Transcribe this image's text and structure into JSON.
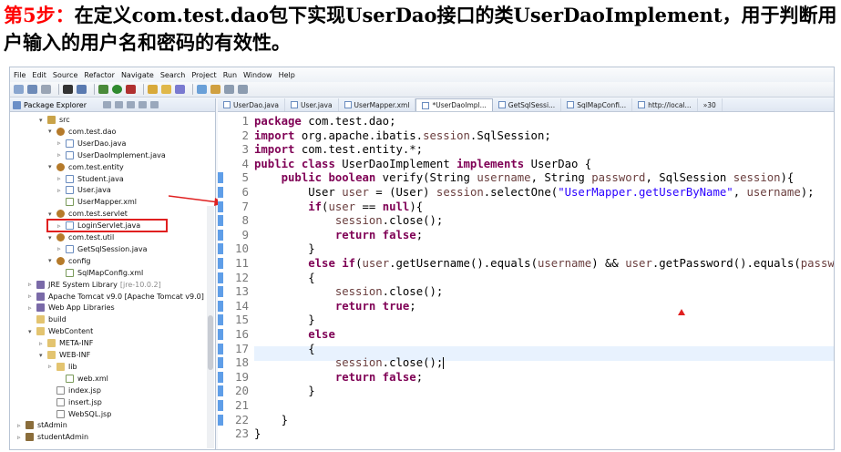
{
  "heading": {
    "step_label": "第5步：",
    "text": "在定义com.test.dao包下实现UserDao接口的类UserDaoImplement，用于判断用户输入的用户名和密码的有效性。"
  },
  "menu": [
    "File",
    "Edit",
    "Source",
    "Refactor",
    "Navigate",
    "Search",
    "Project",
    "Run",
    "Window",
    "Help"
  ],
  "explorer": {
    "title": "Package Explorer",
    "tree": [
      {
        "label": "src",
        "icon": "src",
        "arrow": "▾"
      },
      {
        "label": "com.test.dao",
        "icon": "pkg",
        "arrow": "▾"
      },
      {
        "label": "UserDao.java",
        "icon": "java",
        "arrow": "▹"
      },
      {
        "label": "UserDaoImplement.java",
        "icon": "java",
        "arrow": "▹"
      },
      {
        "label": "com.test.entity",
        "icon": "pkg",
        "arrow": "▾"
      },
      {
        "label": "Student.java",
        "icon": "java",
        "arrow": "▹"
      },
      {
        "label": "User.java",
        "icon": "java",
        "arrow": "▹"
      },
      {
        "label": "UserMapper.xml",
        "icon": "xml",
        "arrow": ""
      },
      {
        "label": "com.test.servlet",
        "icon": "pkg",
        "arrow": "▾"
      },
      {
        "label": "LoginServlet.java",
        "icon": "java",
        "arrow": "▹"
      },
      {
        "label": "com.test.util",
        "icon": "pkg",
        "arrow": "▾"
      },
      {
        "label": "GetSqlSession.java",
        "icon": "java",
        "arrow": "▹"
      },
      {
        "label": "config",
        "icon": "pkg",
        "arrow": "▾"
      },
      {
        "label": "SqlMapConfig.xml",
        "icon": "xml",
        "arrow": ""
      },
      {
        "label": "JRE System Library",
        "icon": "lib",
        "arrow": "▹",
        "suffix": "[jre-10.0.2]"
      },
      {
        "label": "Apache Tomcat v9.0 [Apache Tomcat v9.0]",
        "icon": "lib",
        "arrow": "▹"
      },
      {
        "label": "Web App Libraries",
        "icon": "lib",
        "arrow": "▹"
      },
      {
        "label": "build",
        "icon": "folder",
        "arrow": ""
      },
      {
        "label": "WebContent",
        "icon": "folder",
        "arrow": "▾"
      },
      {
        "label": "META-INF",
        "icon": "folder",
        "arrow": "▹"
      },
      {
        "label": "WEB-INF",
        "icon": "folder",
        "arrow": "▾"
      },
      {
        "label": "lib",
        "icon": "folder",
        "arrow": "▹"
      },
      {
        "label": "web.xml",
        "icon": "xml",
        "arrow": ""
      },
      {
        "label": "index.jsp",
        "icon": "jsp",
        "arrow": ""
      },
      {
        "label": "insert.jsp",
        "icon": "jsp",
        "arrow": ""
      },
      {
        "label": "WebSQL.jsp",
        "icon": "jsp",
        "arrow": ""
      },
      {
        "label": "stAdmin",
        "icon": "proj",
        "arrow": "▹"
      },
      {
        "label": "studentAdmin",
        "icon": "proj",
        "arrow": "▹"
      }
    ]
  },
  "editor_tabs": [
    {
      "label": "UserDao.java",
      "active": false
    },
    {
      "label": "User.java",
      "active": false
    },
    {
      "label": "UserMapper.xml",
      "active": false
    },
    {
      "label": "*UserDaoImpl...",
      "active": true
    },
    {
      "label": "GetSqlSessi...",
      "active": false
    },
    {
      "label": "SqlMapConfi...",
      "active": false
    },
    {
      "label": "http://local...",
      "active": false
    },
    {
      "label": "»30",
      "active": false
    }
  ],
  "code": {
    "line_numbers": [
      "1",
      "2",
      "3",
      "4",
      "5",
      "6",
      "7",
      "8",
      "9",
      "10",
      "11",
      "12",
      "13",
      "14",
      "15",
      "16",
      "17",
      "18",
      "19",
      "20",
      "21",
      "22",
      "23"
    ],
    "lines": [
      "package com.test.dao;",
      "import org.apache.ibatis.session.SqlSession;",
      "import com.test.entity.*;",
      "public class UserDaoImplement implements UserDao {",
      "    public boolean verify(String username, String password, SqlSession session){",
      "        User user = (User) session.selectOne(\"UserMapper.getUserByName\", username);",
      "        if(user == null){",
      "            session.close();",
      "            return false;",
      "        }",
      "        else if(user.getUsername().equals(username) && user.getPassword().equals(password))",
      "        {",
      "            session.close();",
      "            return true;",
      "        }",
      "        else",
      "        {",
      "            session.close();",
      "            return false;",
      "        }",
      "",
      "    }",
      "}"
    ]
  },
  "colors": {
    "keyword": "#7f0055",
    "string": "#2a00ff",
    "highlight_box": "#e02020",
    "current_line": "#e8f2fe"
  }
}
